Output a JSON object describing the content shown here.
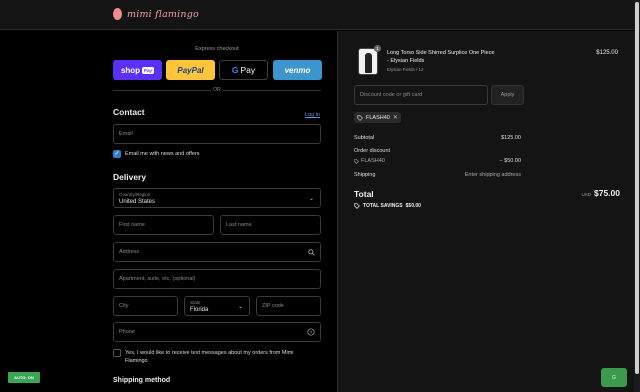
{
  "header": {
    "brand": "mimi flamingo"
  },
  "express": {
    "title": "Express checkout",
    "shop_label": "shop",
    "shop_badge": "Pay",
    "paypal_label": "PayPal",
    "gpay_label": "Pay",
    "venmo_label": "venmo",
    "or": "OR"
  },
  "contact": {
    "heading": "Contact",
    "login": "Log in",
    "email_placeholder": "Email",
    "email_news": "Email me with news and offers"
  },
  "delivery": {
    "heading": "Delivery",
    "country_label": "Country/Region",
    "country_value": "United States",
    "first_name": "First name",
    "last_name": "Last name",
    "address": "Address",
    "apartment": "Apartment, suite, etc. (optional)",
    "city": "City",
    "state_label": "State",
    "state_value": "Florida",
    "zip": "ZIP code",
    "phone": "Phone",
    "sms_text": "Yes, I would like to receive text messages about my orders from Mimi Flamingo"
  },
  "shipping_method": {
    "heading": "Shipping method"
  },
  "auto_button": "AUTO: ON",
  "summary": {
    "product_name": "Long Torso Side Shirred Surplice One Piece - Elysian Fields",
    "product_variant": "Elysian Fields / 12",
    "product_qty": "1",
    "product_price": "$125.00",
    "discount_placeholder": "Discount code or gift card",
    "apply": "Apply",
    "code_chip": "FLASH40",
    "subtotal_label": "Subtotal",
    "subtotal_value": "$125.00",
    "order_discount_label": "Order discount",
    "discount_code": "FLASH40",
    "discount_value": "− $50.00",
    "shipping_label": "Shipping",
    "shipping_value": "Enter shipping address",
    "total_label": "Total",
    "currency": "USD",
    "total_value": "$75.00",
    "savings_label": "TOTAL SAVINGS",
    "savings_value": "$50.00"
  },
  "corner_button": "G"
}
